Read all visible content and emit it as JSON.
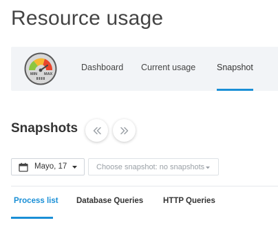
{
  "page": {
    "title": "Resource usage"
  },
  "nav": {
    "logo": {
      "icon": "gauge-icon",
      "min_label": "MIN",
      "max_label": "MAX"
    },
    "items": [
      {
        "label": "Dashboard",
        "active": false
      },
      {
        "label": "Current usage",
        "active": false
      },
      {
        "label": "Snapshot",
        "active": true
      }
    ]
  },
  "snapshots": {
    "title": "Snapshots",
    "prev_icon": "double-chevron-left-icon",
    "next_icon": "double-chevron-right-icon",
    "date_picker": {
      "icon": "calendar-icon",
      "value": "Mayo, 17"
    },
    "snapshot_select": {
      "value": "Choose snapshot: no snapshots"
    }
  },
  "tabs": [
    {
      "label": "Process list",
      "active": true
    },
    {
      "label": "Database Queries",
      "active": false
    },
    {
      "label": "HTTP Queries",
      "active": false
    }
  ],
  "colors": {
    "accent": "#1a8fd6",
    "nav_background": "#f2f4f7"
  }
}
